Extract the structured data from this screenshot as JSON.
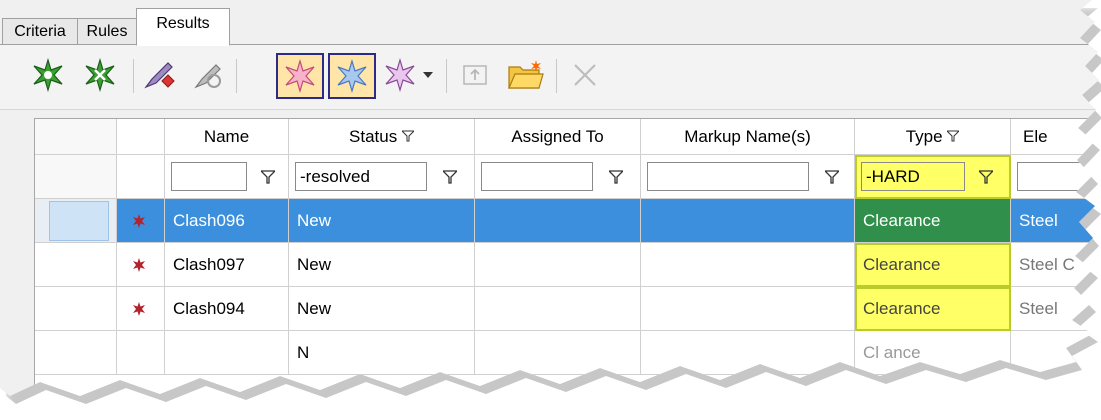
{
  "tabs": [
    {
      "label": "Criteria"
    },
    {
      "label": "Rules"
    },
    {
      "label": "Results"
    }
  ],
  "toolbar": {
    "icons": [
      "new-group-icon",
      "clear-group-icon",
      "add-comment-icon",
      "highlight-all-icon",
      "filter-clash-1-icon",
      "filter-clash-2-icon",
      "filter-clash-3-icon",
      "dropdown-arrow-icon",
      "assign-icon",
      "export-folder-icon",
      "delete-icon"
    ]
  },
  "columns": {
    "name": "Name",
    "status": "Status",
    "assigned_to": "Assigned To",
    "markup_names": "Markup Name(s)",
    "type": "Type",
    "element": "Ele"
  },
  "filters": {
    "name": "",
    "status": "-resolved",
    "assigned_to": "",
    "markup_names": "",
    "type": "-HARD"
  },
  "rows": [
    {
      "name": "Clash096",
      "status": "New",
      "assigned_to": "",
      "markup": "",
      "type": "Clearance",
      "element": "Steel"
    },
    {
      "name": "Clash097",
      "status": "New",
      "assigned_to": "",
      "markup": "",
      "type": "Clearance",
      "element": "Steel C"
    },
    {
      "name": "Clash094",
      "status": "New",
      "assigned_to": "",
      "markup": "",
      "type": "Clearance",
      "element": "Steel"
    },
    {
      "name": "",
      "status": "N",
      "assigned_to": "",
      "markup": "",
      "type": "Cl   ance",
      "element": ""
    }
  ],
  "colors": {
    "selection_blue": "#3b8fdc",
    "highlight_yellow": "#ffff66",
    "highlight_selected_green": "#2f8f4b",
    "clash_red": "#b3232e"
  }
}
